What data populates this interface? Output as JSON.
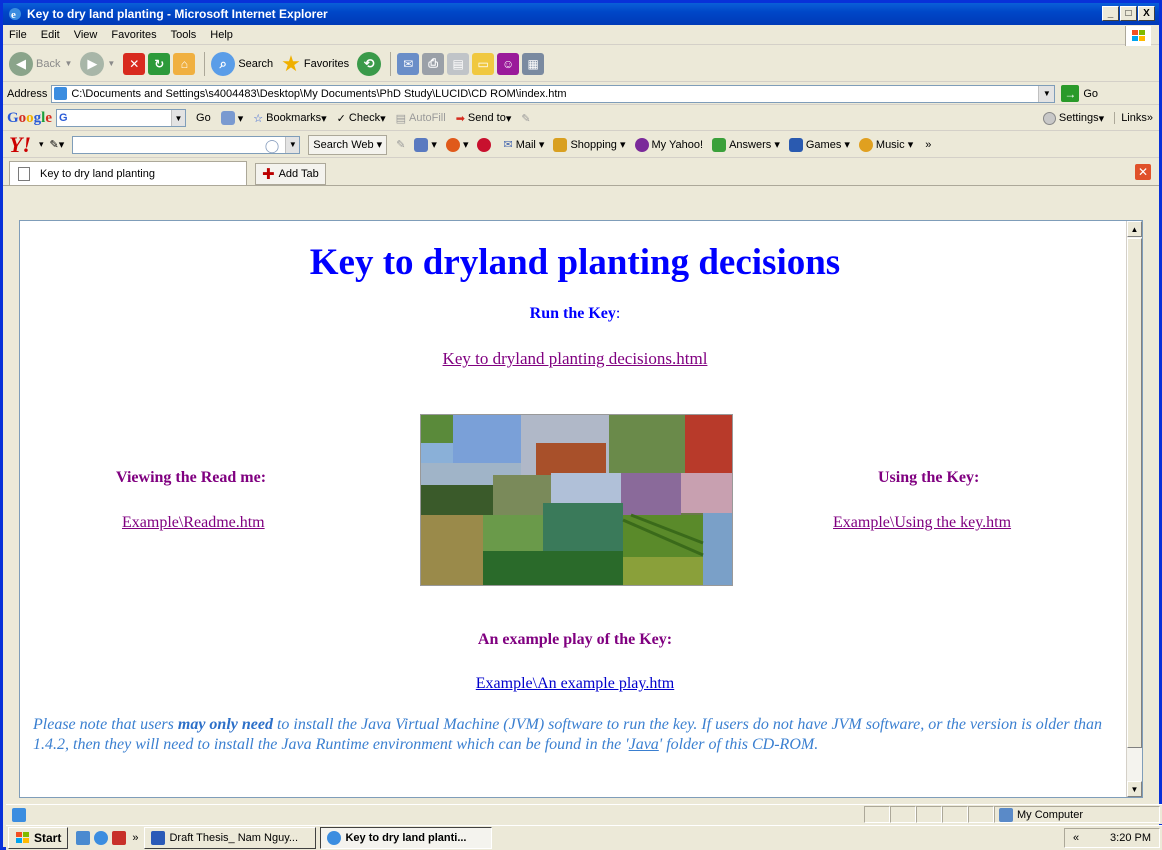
{
  "window": {
    "title": "Key to dry land planting - Microsoft Internet Explorer",
    "btn_min": "_",
    "btn_max": "□",
    "btn_close": "X"
  },
  "menu": [
    "File",
    "Edit",
    "View",
    "Favorites",
    "Tools",
    "Help"
  ],
  "toolbar": {
    "back": "Back",
    "search": "Search",
    "favorites": "Favorites"
  },
  "address": {
    "label": "Address",
    "value": "C:\\Documents and Settings\\s4004483\\Desktop\\My Documents\\PhD Study\\LUCID\\CD ROM\\index.htm",
    "go": "Go"
  },
  "googlebar": {
    "logo": "Google",
    "box": "G",
    "go": "Go",
    "bookmarks": "Bookmarks",
    "check": "Check",
    "autofill": "AutoFill",
    "send_to": "Send to",
    "settings": "Settings",
    "links": "Links"
  },
  "yahoobar": {
    "logo": "Y!",
    "search_web": "Search Web",
    "mail": "Mail",
    "shopping": "Shopping",
    "my_yahoo": "My Yahoo!",
    "answers": "Answers",
    "games": "Games",
    "music": "Music"
  },
  "tabs": {
    "active": "Key to dry land planting",
    "add": "Add Tab"
  },
  "page": {
    "title": "Key to dryland planting decisions",
    "run_label": "Run the Key",
    "run_colon": ":",
    "run_link": "Key to dryland planting decisions.html",
    "readme_label": "Viewing the Read me:",
    "readme_link": "Example\\Readme.htm",
    "using_label": "Using the Key:",
    "using_link": "Example\\Using the key.htm",
    "play_label": "An example play of the Key:",
    "play_link": "Example\\An example play.htm",
    "note_1": "Please note that users ",
    "note_bold": "may only need",
    "note_2": " to install the Java Virtual Machine (JVM) software to run the key. If users do not have JVM software, or the version is older than 1.4.2, then they will need to install the Java Runtime environment which can be found in the '",
    "note_link": "Java",
    "note_3": "' folder of this CD-ROM."
  },
  "status": {
    "zone": "My Computer"
  },
  "taskbar": {
    "start": "Start",
    "task1": "Draft Thesis_ Nam Nguy...",
    "task2": "Key to dry land planti...",
    "chevron": "»",
    "tray_chevron": "«",
    "time": "3:20 PM"
  }
}
